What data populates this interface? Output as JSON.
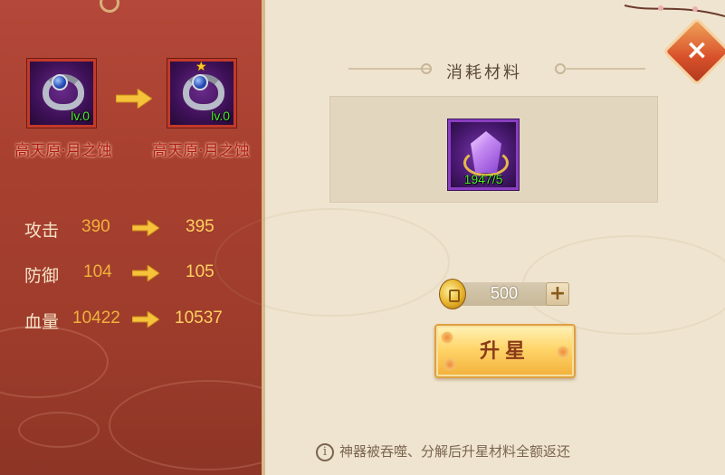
{
  "left": {
    "current_item": {
      "name": "高天原·月之蚀",
      "level": "lv.0",
      "icon": "moon-ring-artifact-icon"
    },
    "next_item": {
      "name": "高天原·月之蚀",
      "level": "lv.0",
      "icon": "moon-ring-artifact-icon",
      "star_icon": "★"
    },
    "stats": [
      {
        "label": "攻击",
        "from": "390",
        "to": "395"
      },
      {
        "label": "防御",
        "from": "104",
        "to": "105"
      },
      {
        "label": "血量",
        "from": "10422",
        "to": "10537"
      }
    ]
  },
  "right": {
    "section_title": "消耗材料",
    "material": {
      "count": "1947/5",
      "icon": "purple-crystal-icon"
    },
    "cost": {
      "amount": "500",
      "icon": "gold-coin-icon",
      "plus": "+"
    },
    "upgrade_label": "升星",
    "notice": "神器被吞噬、分解后升星材料全额返还",
    "info_icon_text": "i",
    "close_label": "×"
  },
  "colors": {
    "left_panel": "#a8402f",
    "right_panel": "#efe4cf",
    "level_text": "#4eea2e",
    "stat_value": "#f0b23a",
    "item_name": "#b01818"
  }
}
